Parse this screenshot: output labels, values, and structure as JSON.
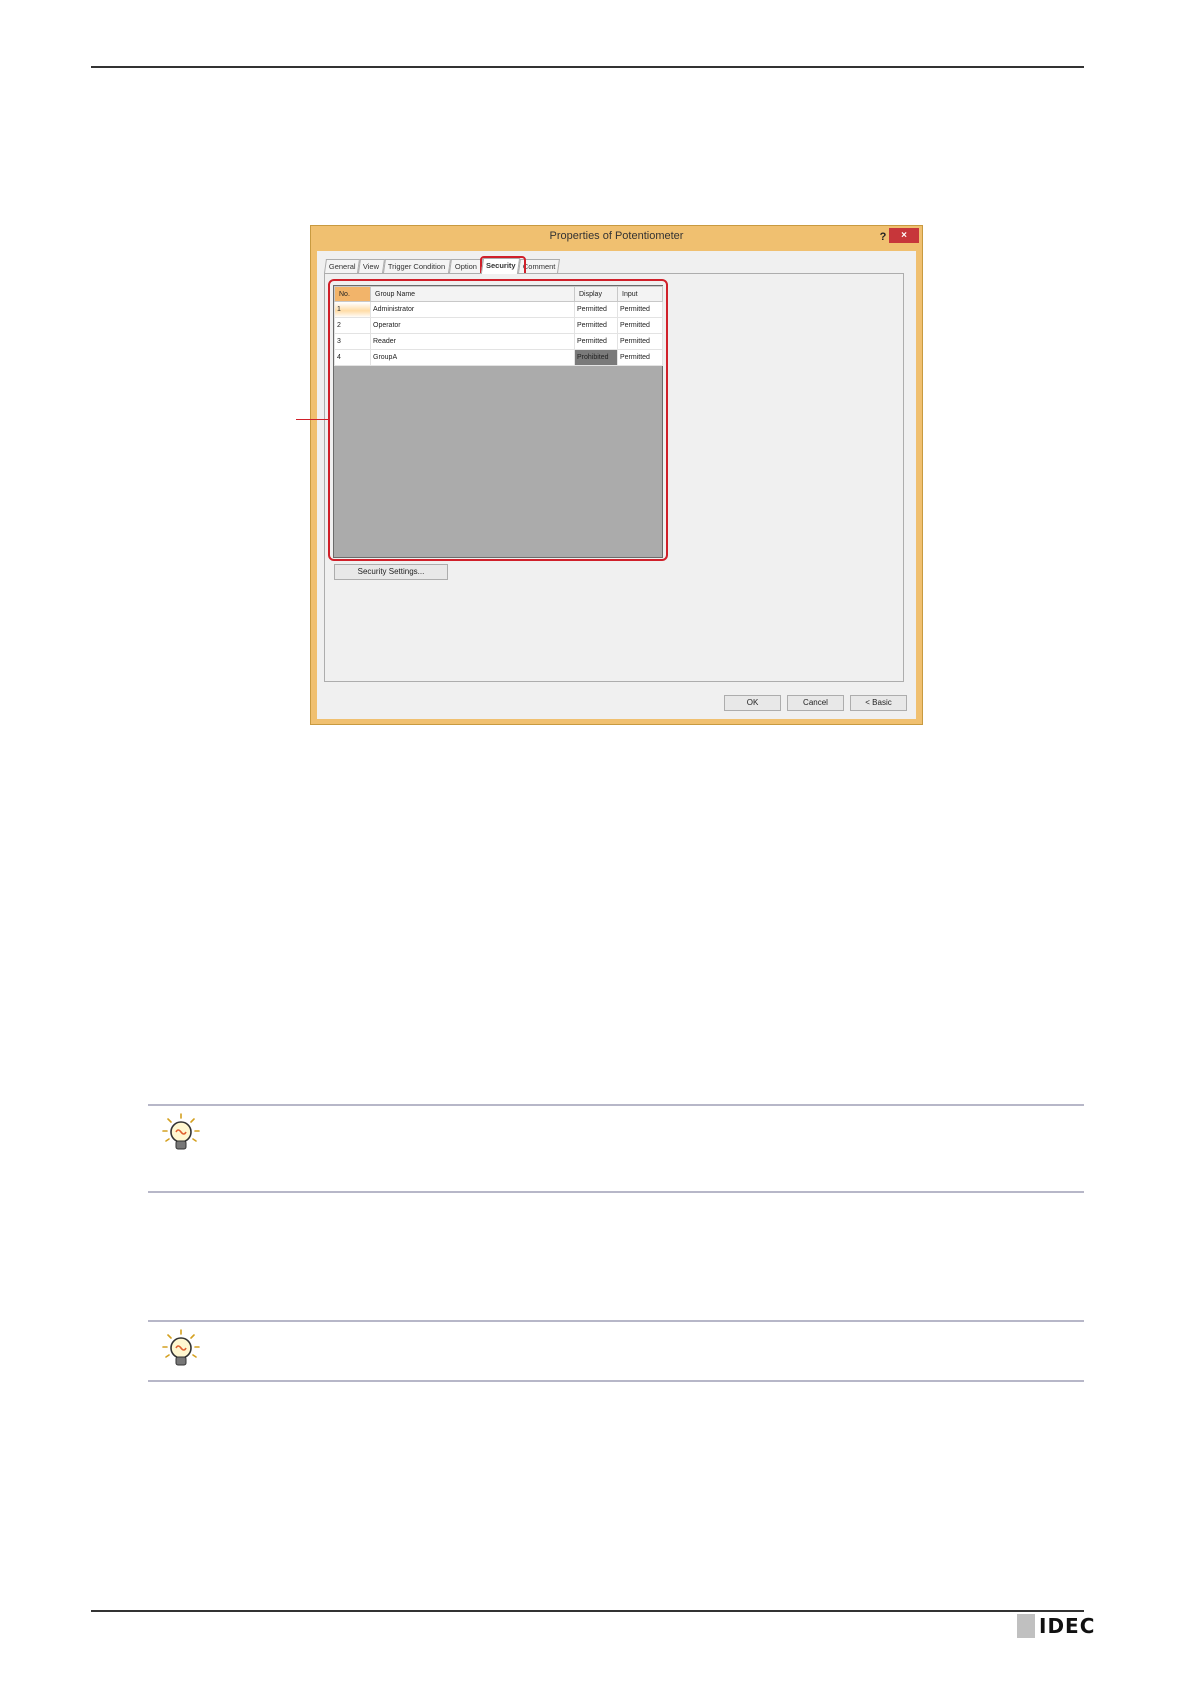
{
  "dialog": {
    "title": "Properties of Potentiometer",
    "help_label": "?",
    "close_label": "×",
    "tabs": [
      "General",
      "View",
      "Trigger Condition",
      "Option",
      "Security",
      "Comment"
    ],
    "active_tab": "Security",
    "table": {
      "headers": [
        "No.",
        "Group Name",
        "Display",
        "Input"
      ],
      "rows": [
        {
          "no": "1",
          "group": "Administrator",
          "display": "Permitted",
          "input": "Permitted"
        },
        {
          "no": "2",
          "group": "Operator",
          "display": "Permitted",
          "input": "Permitted"
        },
        {
          "no": "3",
          "group": "Reader",
          "display": "Permitted",
          "input": "Permitted"
        },
        {
          "no": "4",
          "group": "GroupA",
          "display": "Prohibited",
          "input": "Permitted"
        }
      ]
    },
    "security_settings_button": "Security Settings...",
    "ok_button": "OK",
    "cancel_button": "Cancel",
    "basic_button": "< Basic"
  },
  "footer": {
    "logo_text": "IDEC"
  },
  "colors": {
    "highlight": "#d0202a",
    "dialog_frame": "#f0c070",
    "prohibited_cell": "#7a7a7a"
  },
  "icons": [
    "lightbulb-icon",
    "lightbulb-icon"
  ]
}
